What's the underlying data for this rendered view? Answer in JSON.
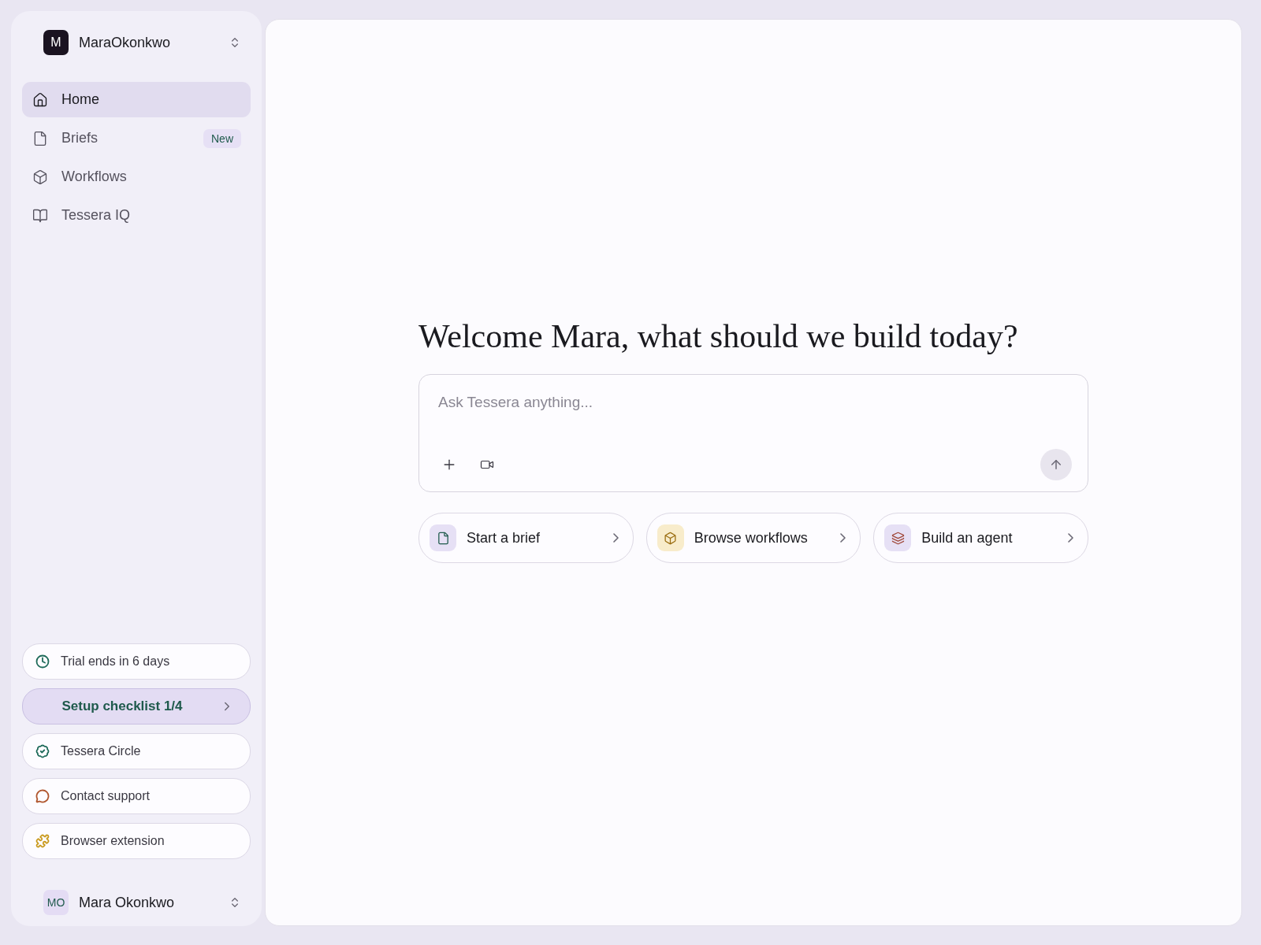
{
  "workspace": {
    "initial": "M",
    "name": "MaraOkonkwo"
  },
  "nav": [
    {
      "kind": "home",
      "label": "Home",
      "selected": true
    },
    {
      "kind": "file",
      "label": "Briefs",
      "selected": false,
      "badge": "New"
    },
    {
      "kind": "box",
      "label": "Workflows",
      "selected": false
    },
    {
      "kind": "book",
      "label": "Tessera IQ",
      "selected": false
    }
  ],
  "footer_links": [
    {
      "kind": "clock",
      "label": "Trial ends in 6 days",
      "color": "#1f6b5a"
    },
    {
      "kind": "checklist",
      "label": "Setup checklist 1/4"
    },
    {
      "kind": "badge",
      "label": "Tessera Circle",
      "color": "#1f6b5a"
    },
    {
      "kind": "chat",
      "label": "Contact support",
      "color": "#b0562e"
    },
    {
      "kind": "puzzle",
      "label": "Browser extension",
      "color": "#c99a1e"
    }
  ],
  "user": {
    "initials": "MO",
    "name": "Mara Okonkwo"
  },
  "heading": "Welcome Mara, what should we build today?",
  "prompt": {
    "placeholder": "Ask Tessera anything..."
  },
  "actions": [
    {
      "kind": "file",
      "label": "Start a brief",
      "color": "#e6e0f5"
    },
    {
      "kind": "box",
      "label": "Browse workflows",
      "color": "#f8eccb"
    },
    {
      "kind": "layers",
      "label": "Build an agent",
      "color": "#e6e0f5"
    }
  ]
}
